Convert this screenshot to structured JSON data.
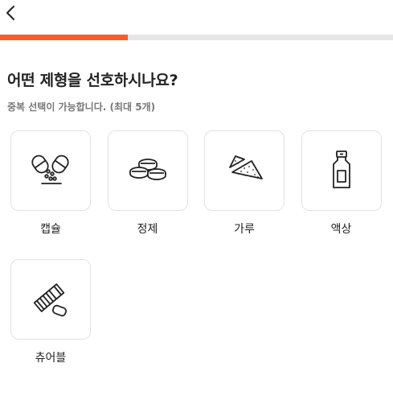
{
  "header": {
    "back_icon": "chevron-left-icon"
  },
  "progress": {
    "fraction": 0.325,
    "fill_color": "#ff5a24",
    "track_color": "#e6e6e6"
  },
  "question": {
    "title": "어떤 제형을 선호하시나요?",
    "subtitle": "중복 선택이 가능합니다. (최대 5개)"
  },
  "options": [
    {
      "label": "캡슐",
      "icon": "capsule-icon"
    },
    {
      "label": "정제",
      "icon": "tablet-icon"
    },
    {
      "label": "가루",
      "icon": "powder-icon"
    },
    {
      "label": "액상",
      "icon": "liquid-bottle-icon"
    },
    {
      "label": "츄어블",
      "icon": "chewable-icon"
    }
  ]
}
